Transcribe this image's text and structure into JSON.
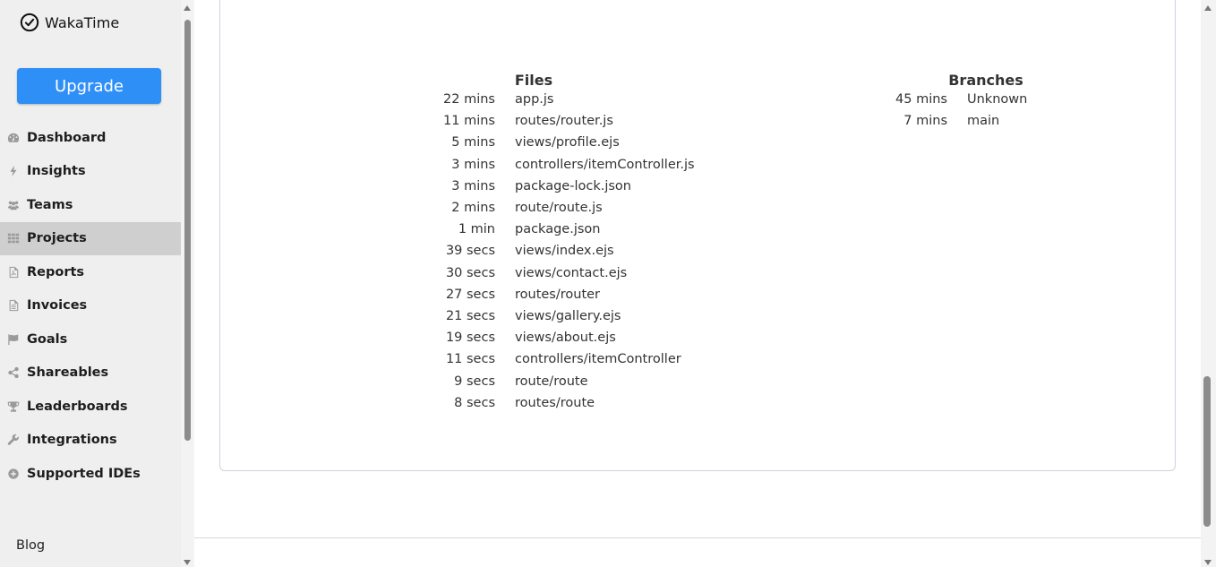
{
  "app": {
    "name": "WakaTime"
  },
  "sidebar": {
    "upgrade_label": "Upgrade",
    "items": [
      {
        "label": "Dashboard",
        "icon": "dashboard-icon"
      },
      {
        "label": "Insights",
        "icon": "bolt-icon"
      },
      {
        "label": "Teams",
        "icon": "users-icon"
      },
      {
        "label": "Projects",
        "icon": "grid-icon",
        "active": true
      },
      {
        "label": "Reports",
        "icon": "pdf-file-icon"
      },
      {
        "label": "Invoices",
        "icon": "document-icon"
      },
      {
        "label": "Goals",
        "icon": "flag-icon"
      },
      {
        "label": "Shareables",
        "icon": "share-icon"
      },
      {
        "label": "Leaderboards",
        "icon": "trophy-icon"
      },
      {
        "label": "Integrations",
        "icon": "wrench-icon"
      },
      {
        "label": "Supported IDEs",
        "icon": "plus-circle-icon"
      }
    ],
    "blog_label": "Blog"
  },
  "files": {
    "title": "Files",
    "rows": [
      {
        "duration": "22 mins",
        "name": "app.js"
      },
      {
        "duration": "11 mins",
        "name": "routes/router.js"
      },
      {
        "duration": "5 mins",
        "name": "views/profile.ejs"
      },
      {
        "duration": "3 mins",
        "name": "controllers/itemController.js"
      },
      {
        "duration": "3 mins",
        "name": "package-lock.json"
      },
      {
        "duration": "2 mins",
        "name": "route/route.js"
      },
      {
        "duration": "1 min",
        "name": "package.json"
      },
      {
        "duration": "39 secs",
        "name": "views/index.ejs"
      },
      {
        "duration": "30 secs",
        "name": "views/contact.ejs"
      },
      {
        "duration": "27 secs",
        "name": "routes/router"
      },
      {
        "duration": "21 secs",
        "name": "views/gallery.ejs"
      },
      {
        "duration": "19 secs",
        "name": "views/about.ejs"
      },
      {
        "duration": "11 secs",
        "name": "controllers/itemController"
      },
      {
        "duration": "9 secs",
        "name": "route/route"
      },
      {
        "duration": "8 secs",
        "name": "routes/route"
      }
    ]
  },
  "branches": {
    "title": "Branches",
    "rows": [
      {
        "duration": "45 mins",
        "name": "Unknown"
      },
      {
        "duration": "7 mins",
        "name": "main"
      }
    ]
  },
  "colors": {
    "accent": "#2e8ff7",
    "sidebar_bg": "#efefef",
    "active_bg": "#cfcfcf"
  }
}
